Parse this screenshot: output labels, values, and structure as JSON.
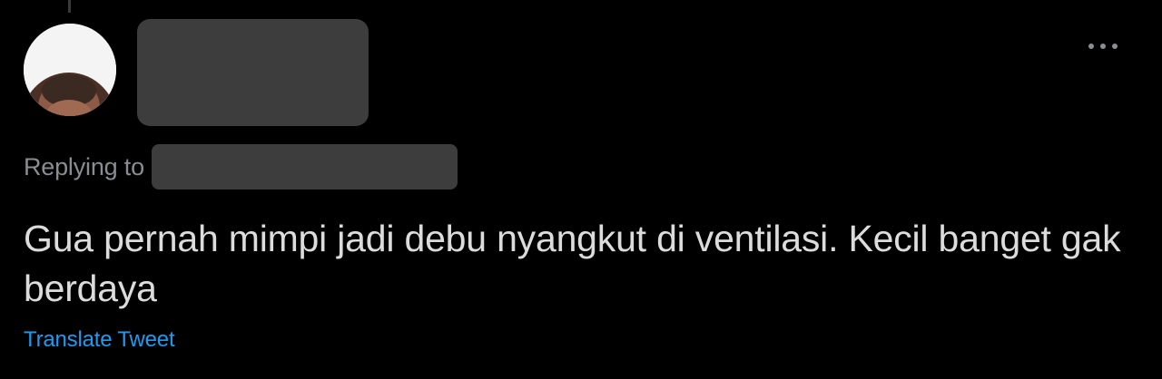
{
  "tweet": {
    "reply_label": "Replying to",
    "text": "Gua pernah mimpi jadi debu nyangkut di ventilasi. Kecil banget gak berdaya",
    "translate_link": "Translate Tweet"
  },
  "icons": {
    "more": "more-horizontal-icon",
    "avatar": "user-avatar"
  },
  "colors": {
    "background": "#000000",
    "text_primary": "#dcdcdc",
    "text_secondary": "#8a8d91",
    "link": "#1d9bf0",
    "redaction": "#3d3d3d"
  }
}
